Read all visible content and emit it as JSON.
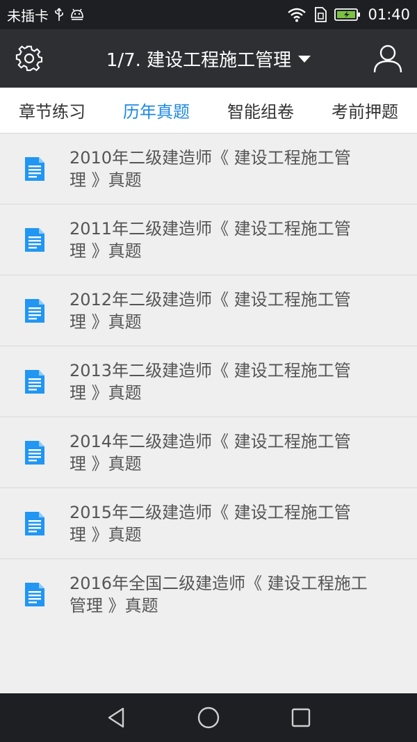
{
  "status_bar": {
    "carrier": "未插卡",
    "time": "01:40",
    "icons": [
      "usb-icon",
      "android-debug-icon",
      "wifi-icon",
      "sim-icon",
      "battery-charging-icon"
    ]
  },
  "header": {
    "title": "1/7. 建设工程施工管理",
    "settings_icon": "gear-icon",
    "user_icon": "user-icon"
  },
  "tabs": [
    {
      "label": "章节练习",
      "active": false
    },
    {
      "label": "历年真题",
      "active": true
    },
    {
      "label": "智能组卷",
      "active": false
    },
    {
      "label": "考前押题",
      "active": false
    }
  ],
  "papers": [
    {
      "line1": "2010年二级建造师《 建设工程施工管",
      "line2": "理 》真题"
    },
    {
      "line1": "2011年二级建造师《 建设工程施工管",
      "line2": "理 》真题"
    },
    {
      "line1": "2012年二级建造师《 建设工程施工管",
      "line2": "理 》真题"
    },
    {
      "line1": "2013年二级建造师《 建设工程施工管",
      "line2": "理 》真题"
    },
    {
      "line1": "2014年二级建造师《 建设工程施工管",
      "line2": "理 》真题"
    },
    {
      "line1": "2015年二级建造师《 建设工程施工管",
      "line2": "理 》真题"
    },
    {
      "line1": "2016年全国二级建造师《 建设工程施工",
      "line2": "管理 》真题"
    }
  ],
  "colors": {
    "accent": "#1e88e5",
    "doc_icon": "#2196f3",
    "header_bg": "#2d2f33",
    "status_bg": "#1d1f22"
  },
  "nav": {
    "back_icon": "back-triangle-icon",
    "home_icon": "home-circle-icon",
    "recents_icon": "recents-square-icon"
  }
}
